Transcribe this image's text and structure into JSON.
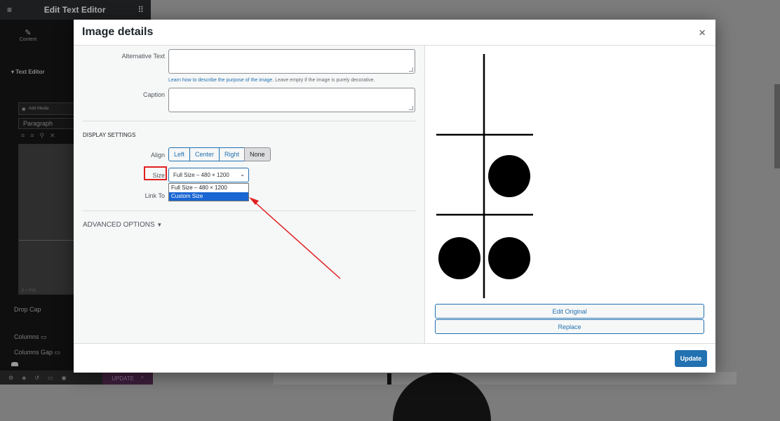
{
  "background": {
    "editor_title": "Edit Text Editor",
    "content_tab": "Content",
    "section_title": "Text Editor",
    "add_media": "Add Media",
    "paragraph": "Paragraph",
    "drop_cap": "Drop Cap",
    "columns": "Columns",
    "columns_gap": "Columns Gap",
    "update": "UPDATE"
  },
  "modal": {
    "title": "Image details",
    "close": "×",
    "alt_text_label": "Alternative Text",
    "alt_text_value": "",
    "alt_help_link": "Learn how to describe the purpose of the image.",
    "alt_help_rest": " Leave empty if the image is purely decorative.",
    "caption_label": "Caption",
    "caption_value": "",
    "display_settings": "Display Settings",
    "align_label": "Align",
    "align_options": [
      "Left",
      "Center",
      "Right",
      "None"
    ],
    "align_selected": "None",
    "size_label": "Size",
    "size_value": "Full Size – 480 × 1200",
    "size_options": [
      "Full Size – 480 × 1200",
      "Custom Size"
    ],
    "size_highlighted": "Custom Size",
    "link_to_label": "Link To",
    "advanced_options": "ADVANCED OPTIONS",
    "edit_original": "Edit Original",
    "replace": "Replace",
    "update": "Update"
  }
}
